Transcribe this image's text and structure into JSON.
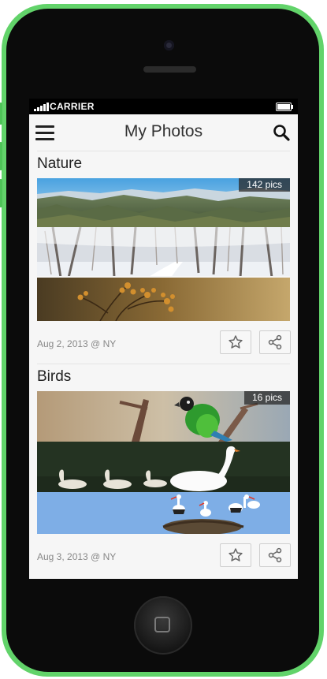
{
  "status_bar": {
    "carrier": "CARRIER"
  },
  "navbar": {
    "title": "My Photos"
  },
  "albums": [
    {
      "name": "Nature",
      "count_label": "142 pics",
      "date_label": "Aug 2, 2013 @ NY"
    },
    {
      "name": "Birds",
      "count_label": "16 pics",
      "date_label": "Aug 3, 2013 @ NY"
    }
  ],
  "icons": {
    "menu": "hamburger-menu-icon",
    "search": "search-icon",
    "favorite": "star-icon",
    "share": "share-icon"
  },
  "colors": {
    "phone_body": "#62d36a",
    "navbar_bg": "#f6f6f6",
    "badge_bg": "#282828"
  }
}
